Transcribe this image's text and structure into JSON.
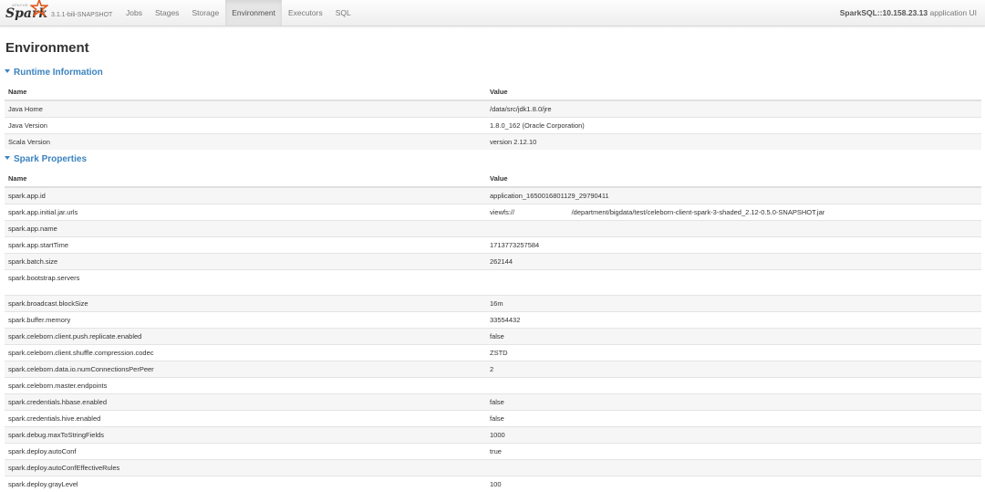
{
  "brand": {
    "word": "Spark",
    "apache": "APACHE",
    "version": "3.1.1-bili-SNAPSHOT"
  },
  "nav": {
    "items": [
      "Jobs",
      "Stages",
      "Storage",
      "Environment",
      "Executors",
      "SQL"
    ],
    "active": "Environment"
  },
  "app_title": {
    "name": "SparkSQL::10.158.23.13",
    "suffix": " application UI"
  },
  "page_title": "Environment",
  "runtime": {
    "title": "Runtime Information",
    "headers": [
      "Name",
      "Value"
    ],
    "rows": [
      [
        "Java Home",
        "/data/src/jdk1.8.0/jre"
      ],
      [
        "Java Version",
        "1.8.0_162 (Oracle Corporation)"
      ],
      [
        "Scala Version",
        "version 2.12.10"
      ]
    ]
  },
  "spark_props": {
    "title": "Spark Properties",
    "headers": [
      "Name",
      "Value"
    ],
    "rows": [
      [
        "spark.app.id",
        "application_1650016801129_29790411"
      ],
      [
        "spark.app.initial.jar.urls",
        "viewfs://                              /department/bigdata/test/celeborn-client-spark-3-shaded_2.12-0.5.0-SNAPSHOT.jar"
      ],
      [
        "spark.app.name",
        ""
      ],
      [
        "spark.app.startTime",
        "1713773257584"
      ],
      [
        "spark.batch.size",
        "262144"
      ],
      [
        "spark.bootstrap.servers",
        ""
      ],
      [
        "spark.broadcast.blockSize",
        "16m"
      ],
      [
        "spark.buffer.memory",
        "33554432"
      ],
      [
        "spark.celeborn.client.push.replicate.enabled",
        "false"
      ],
      [
        "spark.celeborn.client.shuffle.compression.codec",
        "ZSTD"
      ],
      [
        "spark.celeborn.data.io.numConnectionsPerPeer",
        "2"
      ],
      [
        "spark.celeborn.master.endpoints",
        ""
      ],
      [
        "spark.credentials.hbase.enabled",
        "false"
      ],
      [
        "spark.credentials.hive.enabled",
        "false"
      ],
      [
        "spark.debug.maxToStringFields",
        "1000"
      ],
      [
        "spark.deploy.autoConf",
        "true"
      ],
      [
        "spark.deploy.autoConfEffectiveRules",
        ""
      ],
      [
        "spark.deploy.grayLevel",
        "100"
      ]
    ]
  }
}
